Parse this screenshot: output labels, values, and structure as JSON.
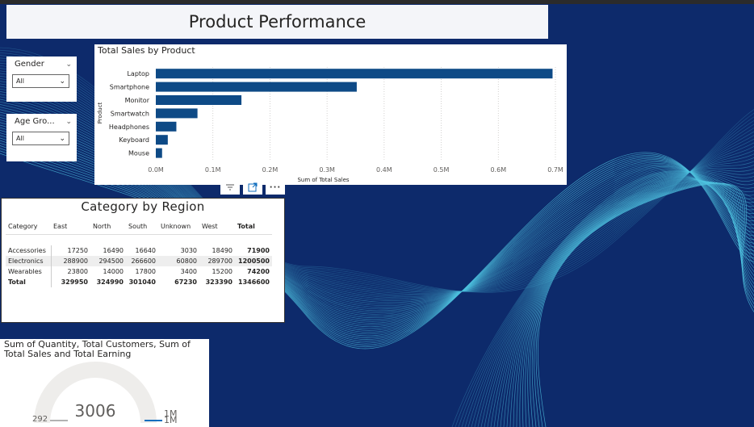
{
  "page_title": "Product Performance",
  "slicers": [
    {
      "label": "Gender",
      "value": "All"
    },
    {
      "label": "Age Gro...",
      "value": "All"
    }
  ],
  "bar_visual": {
    "title": "Total Sales by Product"
  },
  "visual_header_icons": [
    "filter-icon",
    "focus-mode-icon",
    "more-options-icon"
  ],
  "matrix": {
    "title": "Category by Region",
    "columns": [
      "Category",
      "East",
      "North",
      "South",
      "Unknown",
      "West",
      "Total"
    ],
    "rows": [
      {
        "cells": [
          "Accessories",
          "17250",
          "16490",
          "16640",
          "3030",
          "18490",
          "71900"
        ]
      },
      {
        "cells": [
          "Electronics",
          "288900",
          "294500",
          "266600",
          "60800",
          "289700",
          "1200500"
        ]
      },
      {
        "cells": [
          "Wearables",
          "23800",
          "14000",
          "17800",
          "3400",
          "15200",
          "74200"
        ]
      }
    ],
    "total_row": [
      "Total",
      "329950",
      "324990",
      "301040",
      "67230",
      "323390",
      "1346600"
    ]
  },
  "gauge": {
    "title_line1": "Sum of Quantity, Total Customers, Sum of",
    "title_line2": "Total Sales and Total Earning",
    "value": "3006",
    "min": "292",
    "max": "1M",
    "target": "1M",
    "fill_fraction": 0.0
  },
  "colors": {
    "background": "#0d2a6b",
    "bar": "#0e4a86",
    "wave": "#4fc3e0"
  },
  "chart_data": {
    "type": "bar",
    "orientation": "horizontal",
    "title": "Total Sales by Product",
    "xlabel": "Sum of Total Sales",
    "ylabel": "Product",
    "categories": [
      "Laptop",
      "Smartphone",
      "Monitor",
      "Smartwatch",
      "Headphones",
      "Keyboard",
      "Mouse"
    ],
    "values": [
      695000,
      352000,
      150000,
      73000,
      36000,
      21000,
      11000
    ],
    "xlim": [
      0,
      700000
    ],
    "xticks": [
      "0.0M",
      "0.1M",
      "0.2M",
      "0.3M",
      "0.4M",
      "0.5M",
      "0.6M",
      "0.7M"
    ],
    "grid": true,
    "color": "#0e4a86"
  }
}
